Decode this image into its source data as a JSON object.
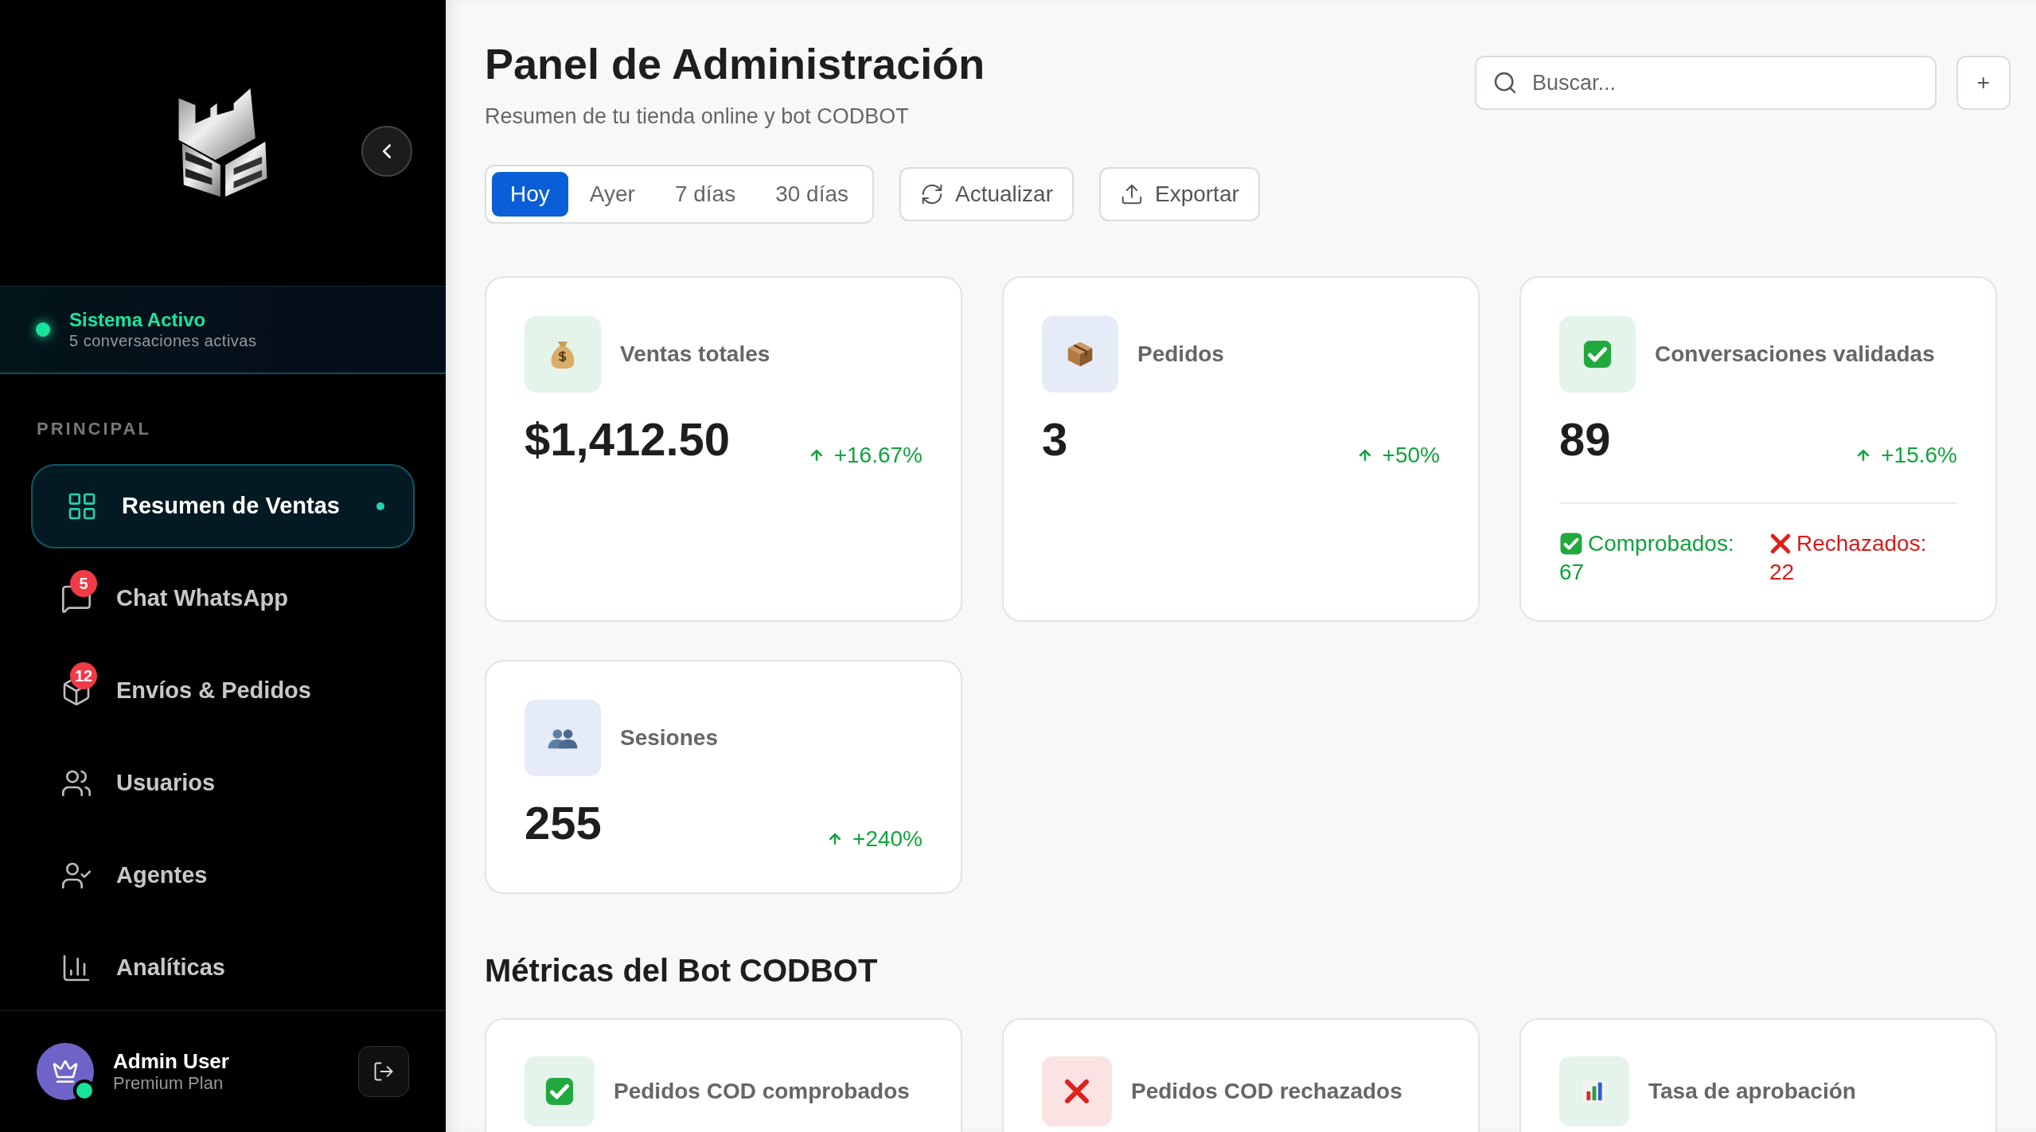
{
  "sidebar": {
    "status": {
      "title": "Sistema Activo",
      "subtitle": "5 conversaciones activas",
      "online": true
    },
    "section_label": "PRINCIPAL",
    "items": [
      {
        "label": "Resumen de Ventas",
        "kind": "grid",
        "selected": true
      },
      {
        "label": "Chat WhatsApp",
        "kind": "chat",
        "badge": "5",
        "selected": false
      },
      {
        "label": "Envíos & Pedidos",
        "kind": "box",
        "badge": "12",
        "selected": false
      },
      {
        "label": "Usuarios",
        "kind": "users",
        "selected": false
      },
      {
        "label": "Agentes",
        "kind": "agent",
        "selected": false
      },
      {
        "label": "Analíticas",
        "kind": "chart",
        "selected": false
      }
    ],
    "user": {
      "name": "Admin User",
      "plan": "Premium Plan",
      "online": true
    }
  },
  "header": {
    "title": "Panel de Administración",
    "subtitle": "Resumen de tu tienda online y bot CODBOT",
    "search": {
      "placeholder": "Buscar..."
    },
    "add_button": "+",
    "periods": [
      {
        "label": "Hoy",
        "selected": true
      },
      {
        "label": "Ayer",
        "selected": false
      },
      {
        "label": "7 días",
        "selected": false
      },
      {
        "label": "30 días",
        "selected": false
      }
    ],
    "actions": [
      {
        "label": "Actualizar",
        "kind": "refresh"
      },
      {
        "label": "Exportar",
        "kind": "export"
      }
    ]
  },
  "stats": [
    {
      "label": "Ventas totales",
      "kind": "money",
      "value": "$1,412.50",
      "change": "+16.67%"
    },
    {
      "label": "Pedidos",
      "kind": "box",
      "value": "3",
      "change": "+50%"
    },
    {
      "label": "Conversaciones validadas",
      "kind": "check",
      "value": "89",
      "change": "+15.6%",
      "breakdown": [
        {
          "label": "Comprobados:",
          "value": "67",
          "kind": "ok"
        },
        {
          "label": "Rechazados:",
          "value": "22",
          "kind": "fail"
        }
      ]
    },
    {
      "label": "Sesiones",
      "kind": "people",
      "value": "255",
      "change": "+240%"
    }
  ],
  "bot_metrics": {
    "title": "Métricas del Bot CODBOT",
    "cards": [
      {
        "label": "Pedidos COD comprobados",
        "kind": "check"
      },
      {
        "label": "Pedidos COD rechazados",
        "kind": "cross"
      },
      {
        "label": "Tasa de aprobación",
        "kind": "bars"
      }
    ]
  }
}
